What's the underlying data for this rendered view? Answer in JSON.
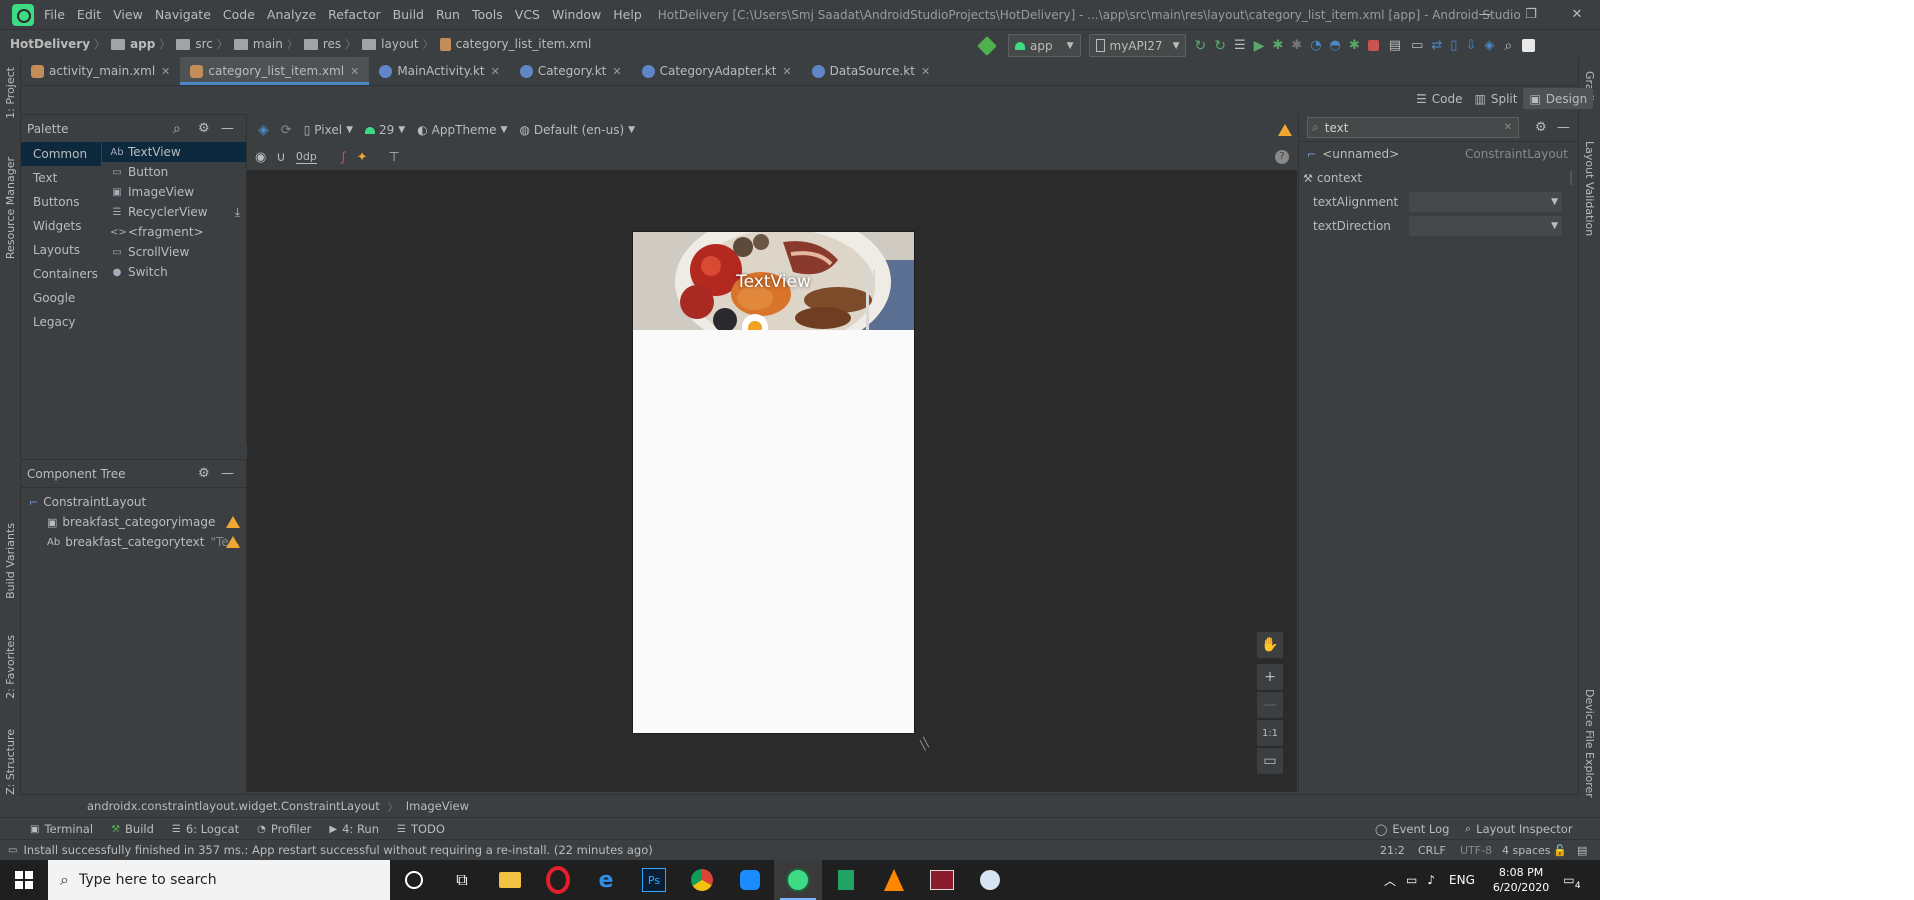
{
  "window": {
    "title": "HotDelivery [C:\\Users\\Smj Saadat\\AndroidStudioProjects\\HotDelivery] - ...\\app\\src\\main\\res\\layout\\category_list_item.xml [app] - Android Studio",
    "controls": [
      "—",
      "❐",
      "✕"
    ]
  },
  "menu": [
    "File",
    "Edit",
    "View",
    "Navigate",
    "Code",
    "Analyze",
    "Refactor",
    "Build",
    "Run",
    "Tools",
    "VCS",
    "Window",
    "Help"
  ],
  "breadcrumb": [
    "HotDelivery",
    "app",
    "src",
    "main",
    "res",
    "layout",
    "category_list_item.xml"
  ],
  "run_toolbar": {
    "config": "app",
    "device": "myAPI27"
  },
  "editor_tabs": [
    {
      "label": "activity_main.xml",
      "type": "xml"
    },
    {
      "label": "category_list_item.xml",
      "type": "xml",
      "active": true
    },
    {
      "label": "MainActivity.kt",
      "type": "kt"
    },
    {
      "label": "Category.kt",
      "type": "kt"
    },
    {
      "label": "CategoryAdapter.kt",
      "type": "kt"
    },
    {
      "label": "DataSource.kt",
      "type": "kt"
    }
  ],
  "view_modes": {
    "code": "Code",
    "split": "Split",
    "design": "Design"
  },
  "design_toolbar": {
    "device": "Pixel",
    "api": "29",
    "theme": "AppTheme",
    "locale": "Default (en-us)",
    "margin": "0dp"
  },
  "palette": {
    "title": "Palette",
    "categories": [
      "Common",
      "Text",
      "Buttons",
      "Widgets",
      "Layouts",
      "Containers",
      "Google",
      "Legacy"
    ],
    "widgets": [
      {
        "icon": "Ab",
        "label": "TextView"
      },
      {
        "icon": "▭",
        "label": "Button"
      },
      {
        "icon": "▣",
        "label": "ImageView"
      },
      {
        "icon": "☰",
        "label": "RecyclerView"
      },
      {
        "icon": "<>",
        "label": "<fragment>"
      },
      {
        "icon": "▭",
        "label": "ScrollView"
      },
      {
        "icon": "●",
        "label": "Switch"
      }
    ]
  },
  "component_tree": {
    "title": "Component Tree",
    "root": "ConstraintLayout",
    "children": [
      {
        "icon": "▣",
        "label": "breakfast_categoryimage",
        "hint": ""
      },
      {
        "icon": "Ab",
        "label": "breakfast_categorytext",
        "hint": "\"Te..."
      }
    ]
  },
  "preview": {
    "text": "TextView"
  },
  "zoom": {
    "fit": "1:1"
  },
  "attributes": {
    "search": "text",
    "component": "<unnamed>",
    "component_type": "ConstraintLayout",
    "rows": [
      "context",
      "textAlignment",
      "textDirection"
    ]
  },
  "bottom_breadcrumb": [
    "androidx.constraintlayout.widget.ConstraintLayout",
    "ImageView"
  ],
  "tool_windows_left": [
    "Terminal",
    "Build",
    "6: Logcat",
    "Profiler",
    "4: Run",
    "TODO"
  ],
  "tool_windows_right": [
    "Event Log",
    "Layout Inspector"
  ],
  "status": {
    "message": "Install successfully finished in 357 ms.: App restart successful without requiring a re-install. (22 minutes ago)",
    "position": "21:2",
    "line_sep": "CRLF",
    "encoding": "UTF-8",
    "indent": "4 spaces"
  },
  "side_tabs_left": [
    "1: Project",
    "Resource Manager",
    "Build Variants",
    "2: Favorites",
    "Z: Structure"
  ],
  "side_tabs_right": [
    "Gradle",
    "Layout Validation",
    "Device File Explorer"
  ],
  "taskbar": {
    "search_placeholder": "Type here to search",
    "language": "ENG",
    "time": "8:08 PM",
    "date": "6/20/2020",
    "notifications": "4"
  }
}
